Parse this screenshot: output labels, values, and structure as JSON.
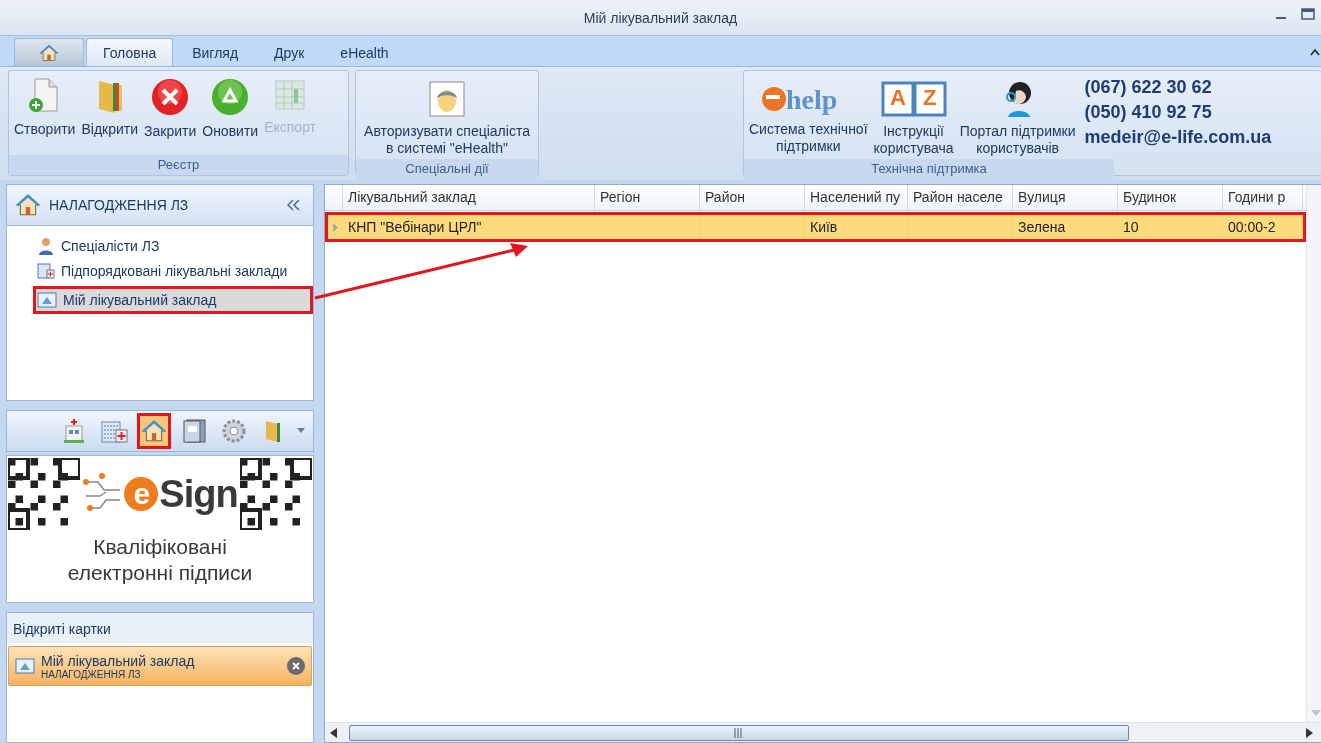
{
  "window": {
    "title": "Мій лікувальний заклад"
  },
  "tabs": [
    {
      "kind": "home",
      "selected": false
    },
    {
      "kind": "text",
      "label": "Головна",
      "selected": true
    },
    {
      "kind": "text",
      "label": "Вигляд",
      "selected": false
    },
    {
      "kind": "text",
      "label": "Друк",
      "selected": false
    },
    {
      "kind": "text",
      "label": "eHealth",
      "selected": false
    }
  ],
  "ribbon": {
    "groups": [
      {
        "title": "Реєстр",
        "buttons": [
          {
            "label": "Створити",
            "disabled": false
          },
          {
            "label": "Відкрити",
            "disabled": false
          },
          {
            "label": "Закрити",
            "disabled": false
          },
          {
            "label": "Оновити",
            "disabled": false
          },
          {
            "label": "Експорт",
            "disabled": true
          }
        ]
      },
      {
        "title": "Спеціальні дії",
        "buttons": [
          {
            "label": "Авторизувати спеціаліста\nв системі \"eHealth\"",
            "disabled": false
          }
        ]
      }
    ],
    "support": {
      "title": "Технічна підтримка",
      "items": [
        {
          "kind": "ehelp",
          "logo_text": "help",
          "label": "Система технічної\nпідтримки"
        },
        {
          "kind": "book",
          "letters": [
            "A",
            "Z"
          ],
          "label": "Інструкції\nкористувача"
        },
        {
          "kind": "headset",
          "label": "Портал підтримки\nкористувачів"
        }
      ],
      "contacts": [
        "(067) 622 30 62",
        "(050) 410 92 75",
        "medeir@e-life.com.ua"
      ]
    }
  },
  "navigator": {
    "title": "НАЛАГОДЖЕННЯ ЛЗ",
    "items": [
      {
        "label": "Спеціалісти ЛЗ",
        "selected": false,
        "annotated": false
      },
      {
        "label": "Підпорядковані лікувальні заклади",
        "selected": false,
        "annotated": false
      },
      {
        "label": "Мій лікувальний заклад",
        "selected": true,
        "annotated": true
      }
    ],
    "toolbar": [
      {
        "selected": false,
        "annotated": false
      },
      {
        "selected": false,
        "annotated": false
      },
      {
        "selected": true,
        "annotated": true
      },
      {
        "selected": false,
        "annotated": false
      },
      {
        "selected": false,
        "annotated": false
      },
      {
        "selected": false,
        "annotated": false
      }
    ]
  },
  "banner": {
    "brand_initial": "e",
    "brand": "Sign",
    "text": "Кваліфіковані\nелектронні підписи"
  },
  "open_cards": {
    "title": "Відкриті картки",
    "cards": [
      {
        "title": "Мій лікувальний заклад",
        "subtitle": "НАЛАГОДЖЕННЯ ЛЗ"
      }
    ]
  },
  "table": {
    "columns": [
      "Лікувальний заклад",
      "Регіон",
      "Район",
      "Населений пу",
      "Район населе",
      "Вулиця",
      "Будинок",
      "Години р"
    ],
    "rows": [
      {
        "selected": true,
        "annotated": true,
        "cells": [
          "КНП \"Вебінари ЦРЛ\"",
          null,
          null,
          "Київ",
          null,
          "Зелена",
          "10",
          "00:00-2"
        ]
      }
    ]
  }
}
